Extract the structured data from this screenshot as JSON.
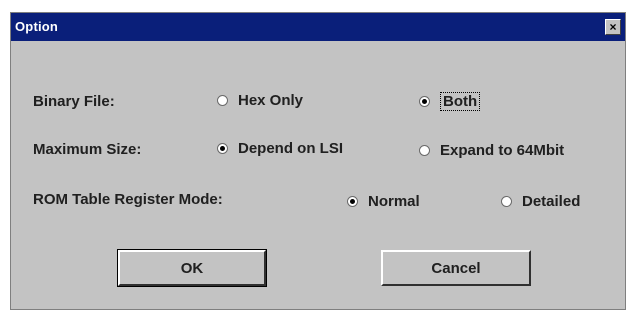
{
  "window": {
    "title": "Option",
    "close_glyph": "×"
  },
  "binary_file": {
    "label": "Binary File:",
    "options": [
      "Hex Only",
      "Both"
    ],
    "selected": "Both"
  },
  "maximum_size": {
    "label": "Maximum Size:",
    "options": [
      "Depend on LSI",
      "Expand to 64Mbit"
    ],
    "selected": "Depend on LSI"
  },
  "rom_table_register_mode": {
    "label": "ROM Table Register Mode:",
    "options": [
      "Normal",
      "Detailed"
    ],
    "selected": "Normal"
  },
  "buttons": {
    "ok": "OK",
    "cancel": "Cancel"
  },
  "colors": {
    "titlebar": "#0a1f7a",
    "face": "#c3c3c3"
  }
}
